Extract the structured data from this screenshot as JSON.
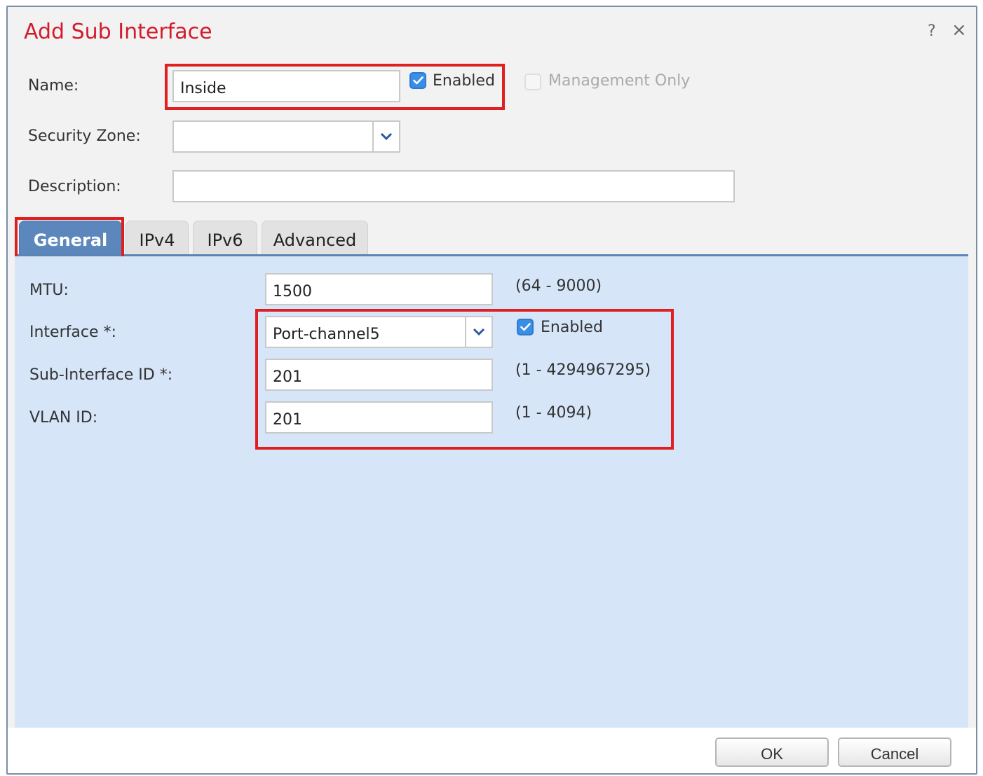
{
  "dialog": {
    "title": "Add Sub Interface",
    "help": "?",
    "close": "×"
  },
  "top": {
    "name_label": "Name:",
    "name_value": "Inside",
    "enabled_label": "Enabled",
    "enabled_checked": true,
    "mgmt_label": "Management Only",
    "mgmt_checked": false,
    "zone_label": "Security Zone:",
    "zone_value": "",
    "desc_label": "Description:",
    "desc_value": ""
  },
  "tabs": [
    {
      "label": "General",
      "active": true
    },
    {
      "label": "IPv4",
      "active": false
    },
    {
      "label": "IPv6",
      "active": false
    },
    {
      "label": "Advanced",
      "active": false
    }
  ],
  "general": {
    "mtu_label": "MTU:",
    "mtu_value": "1500",
    "mtu_range": "(64 - 9000)",
    "interface_label": "Interface *:",
    "interface_value": "Port-channel5",
    "interface_enabled_label": "Enabled",
    "interface_enabled_checked": true,
    "subif_label": "Sub-Interface ID *:",
    "subif_value": "201",
    "subif_range": "(1 - 4294967295)",
    "vlan_label": "VLAN ID:",
    "vlan_value": "201",
    "vlan_range": "(1 - 4094)"
  },
  "buttons": {
    "ok": "OK",
    "cancel": "Cancel"
  },
  "colors": {
    "title": "#d21c2c",
    "highlight": "#e02020",
    "tab_active": "#5b87bd",
    "panel": "#d6e5f8",
    "checkbox": "#3a8ee6"
  }
}
